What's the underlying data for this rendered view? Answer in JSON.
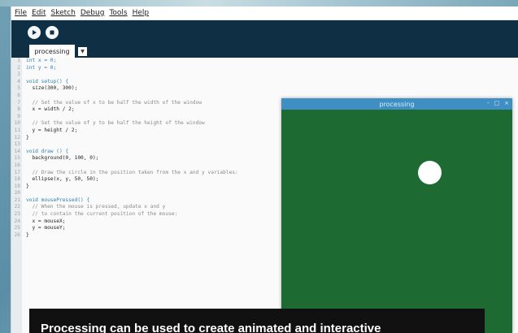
{
  "menu": {
    "items": [
      "File",
      "Edit",
      "Sketch",
      "Debug",
      "Tools",
      "Help"
    ]
  },
  "toolbar": {
    "run_icon": "play-icon",
    "stop_icon": "stop-icon"
  },
  "tabs": {
    "active_label": "processing",
    "arrow": "▼"
  },
  "editor": {
    "lines": [
      {
        "n": "1",
        "t": "int x = 0;"
      },
      {
        "n": "2",
        "t": "int y = 0;"
      },
      {
        "n": "3",
        "t": ""
      },
      {
        "n": "4",
        "t": "void setup() {"
      },
      {
        "n": "5",
        "t": "  size(300, 300);"
      },
      {
        "n": "6",
        "t": ""
      },
      {
        "n": "7",
        "t": "  // Set the value of x to be half the width of the window"
      },
      {
        "n": "8",
        "t": "  x = width / 2;"
      },
      {
        "n": "9",
        "t": ""
      },
      {
        "n": "10",
        "t": "  // Set the value of y to be half the height of the window"
      },
      {
        "n": "11",
        "t": "  y = height / 2;"
      },
      {
        "n": "12",
        "t": "}"
      },
      {
        "n": "13",
        "t": ""
      },
      {
        "n": "14",
        "t": "void draw () {"
      },
      {
        "n": "15",
        "t": "  background(0, 100, 0);"
      },
      {
        "n": "16",
        "t": ""
      },
      {
        "n": "17",
        "t": "  // Draw the circle in the position taken from the x and y variables:"
      },
      {
        "n": "18",
        "t": "  ellipse(x, y, 50, 50);"
      },
      {
        "n": "19",
        "t": "}"
      },
      {
        "n": "20",
        "t": ""
      },
      {
        "n": "21",
        "t": "void mousePressed() {"
      },
      {
        "n": "22",
        "t": "  // When the mouse is pressed, update x and y"
      },
      {
        "n": "23",
        "t": "  // to contain the current position of the mouse:"
      },
      {
        "n": "24",
        "t": "  x = mouseX;"
      },
      {
        "n": "25",
        "t": "  y = mouseY;"
      },
      {
        "n": "26",
        "t": "}"
      }
    ]
  },
  "sketch_window": {
    "title": "processing",
    "controls": [
      "-",
      "□",
      "×"
    ],
    "background_color": "#1d6b33",
    "ball_color": "#ffffff"
  },
  "caption": {
    "text": "Processing can be used to create animated and interactive"
  },
  "colors": {
    "toolbar": "#0e2f44",
    "title_bar": "#3f8fc4"
  }
}
